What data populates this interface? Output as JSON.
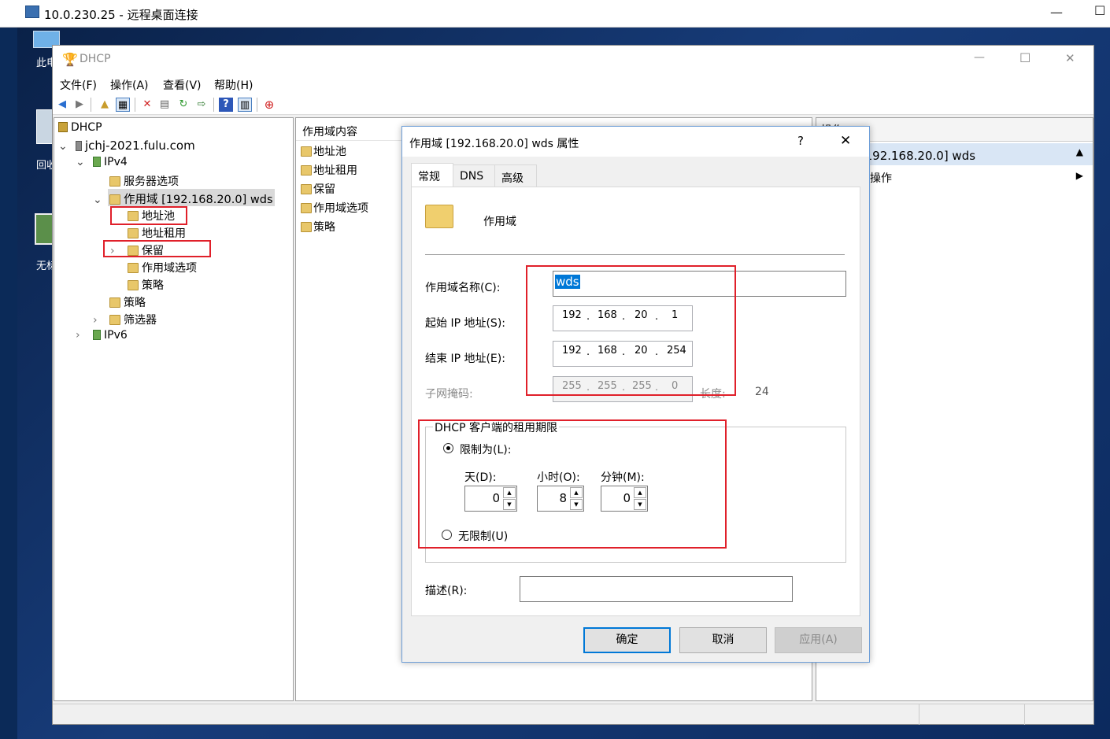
{
  "rdp": {
    "title": "10.0.230.25 - 远程桌面连接",
    "minimize": "—",
    "restore": "☐"
  },
  "desktop": {
    "icon1": "此电",
    "icon2": "回收",
    "icon3": "无标"
  },
  "window": {
    "title": "DHCP",
    "controls": {
      "min": "—",
      "max": "☐",
      "close": "✕"
    },
    "menu": [
      "文件(F)",
      "操作(A)",
      "查看(V)",
      "帮助(H)"
    ]
  },
  "tree": {
    "root": "DHCP",
    "server": "jchj-2021.fulu.com",
    "ipv4": "IPv4",
    "server_options": "服务器选项",
    "scope": "作用域 [192.168.20.0] wds",
    "address_pool": "地址池",
    "address_leases": "地址租用",
    "reservations": "保留",
    "scope_options": "作用域选项",
    "policies_scope": "策略",
    "policies": "策略",
    "filters": "筛选器",
    "ipv6": "IPv6"
  },
  "middle": {
    "header": "作用域内容",
    "items": [
      "地址池",
      "地址租用",
      "保留",
      "作用域选项",
      "策略"
    ]
  },
  "actions": {
    "header": "操作",
    "scope": "作用域 [192.168.20.0] wds",
    "more": "更多操作"
  },
  "dialog": {
    "title": "作用域 [192.168.20.0] wds 属性",
    "help": "?",
    "close": "✕",
    "tabs": [
      "常规",
      "DNS",
      "高级"
    ],
    "section_label": "作用域",
    "scope_name_label": "作用域名称(C):",
    "scope_name_value": "wds",
    "start_ip_label": "起始 IP 地址(S):",
    "start_ip": [
      "192",
      "168",
      "20",
      "1"
    ],
    "end_ip_label": "结束 IP 地址(E):",
    "end_ip": [
      "192",
      "168",
      "20",
      "254"
    ],
    "mask_label": "子网掩码:",
    "mask": [
      "255",
      "255",
      "255",
      "0"
    ],
    "length_label": "长度:",
    "length_value": "24",
    "lease_group": "DHCP 客户端的租用期限",
    "limited_label": "限制为(L):",
    "days_label": "天(D):",
    "days": "0",
    "hours_label": "小时(O):",
    "hours": "8",
    "minutes_label": "分钟(M):",
    "minutes": "0",
    "unlimited_label": "无限制(U)",
    "desc_label": "描述(R):",
    "desc_value": "",
    "ok": "确定",
    "cancel": "取消",
    "apply": "应用(A)"
  }
}
